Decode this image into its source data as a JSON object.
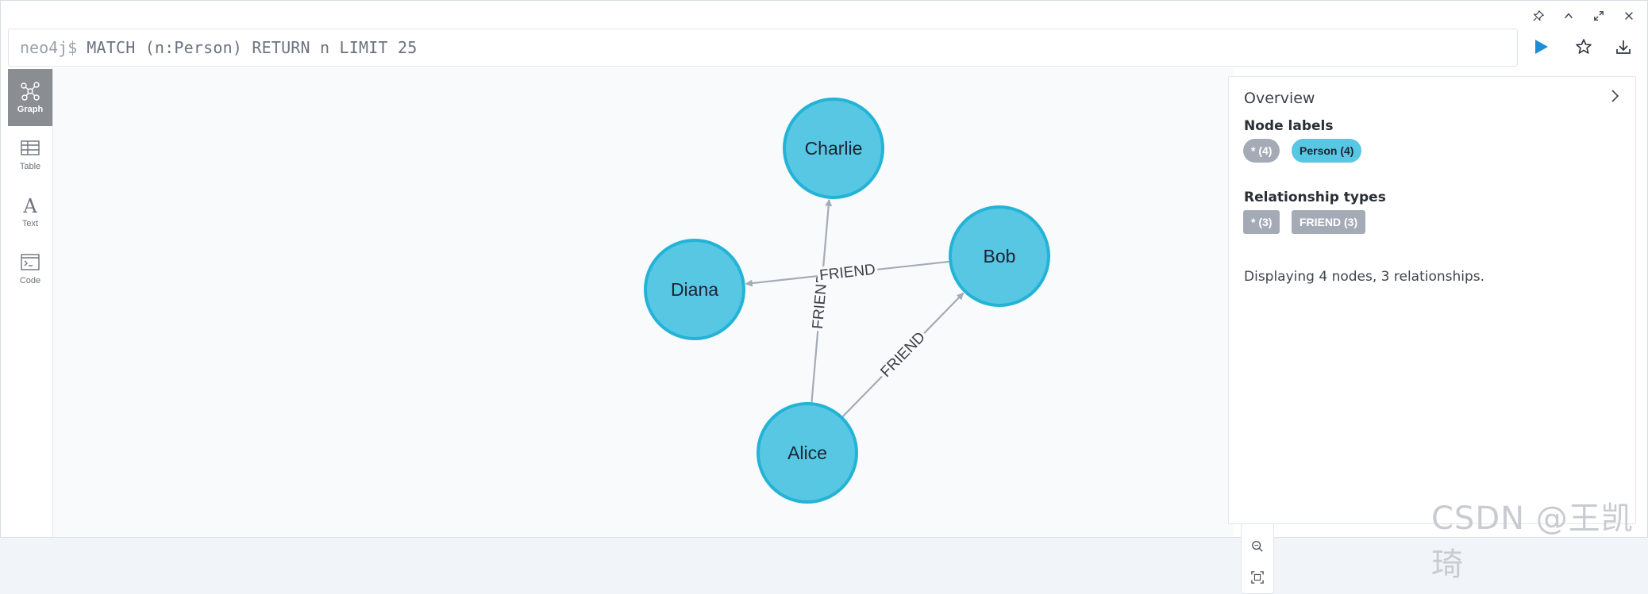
{
  "window": {
    "controls": [
      {
        "icon": "pin-icon"
      },
      {
        "icon": "chevron-up-icon"
      },
      {
        "icon": "expand-icon"
      },
      {
        "icon": "close-icon"
      }
    ]
  },
  "editor": {
    "prompt": "neo4j$",
    "query": "MATCH (n:Person) RETURN n LIMIT 25",
    "run_icon": "play-icon",
    "favorite_icon": "star-icon",
    "download_icon": "download-icon"
  },
  "views": [
    {
      "label": "Graph",
      "icon": "graph-icon",
      "active": true
    },
    {
      "label": "Table",
      "icon": "table-icon",
      "active": false
    },
    {
      "label": "Text",
      "icon": "text-icon",
      "active": false
    },
    {
      "label": "Code",
      "icon": "code-icon",
      "active": false
    }
  ],
  "graph": {
    "node_color": "#57c7e3",
    "node_border": "#23b3d7",
    "nodes": [
      "Charlie",
      "Diana",
      "Bob",
      "Alice"
    ],
    "relationships": [
      {
        "from": "Alice",
        "to": "Charlie",
        "type": "FRIEND"
      },
      {
        "from": "Alice",
        "to": "Bob",
        "type": "FRIEND"
      },
      {
        "from": "Bob",
        "to": "Diana",
        "type": "FRIEND"
      }
    ]
  },
  "zoom": {
    "zoom_in_icon": "zoom-in-icon",
    "zoom_out_icon": "zoom-out-icon",
    "fit_icon": "fit-screen-icon"
  },
  "overview": {
    "title": "Overview",
    "node_labels_heading": "Node labels",
    "node_labels": [
      {
        "text": "* (4)",
        "style": "grey"
      },
      {
        "text": "Person (4)",
        "style": "blue"
      }
    ],
    "relationship_types_heading": "Relationship types",
    "relationship_types": [
      {
        "text": "* (3)",
        "style": "grey"
      },
      {
        "text": "FRIEND (3)",
        "style": "grey"
      }
    ],
    "summary": "Displaying 4 nodes, 3 relationships."
  },
  "watermark": "CSDN @王凯琦"
}
